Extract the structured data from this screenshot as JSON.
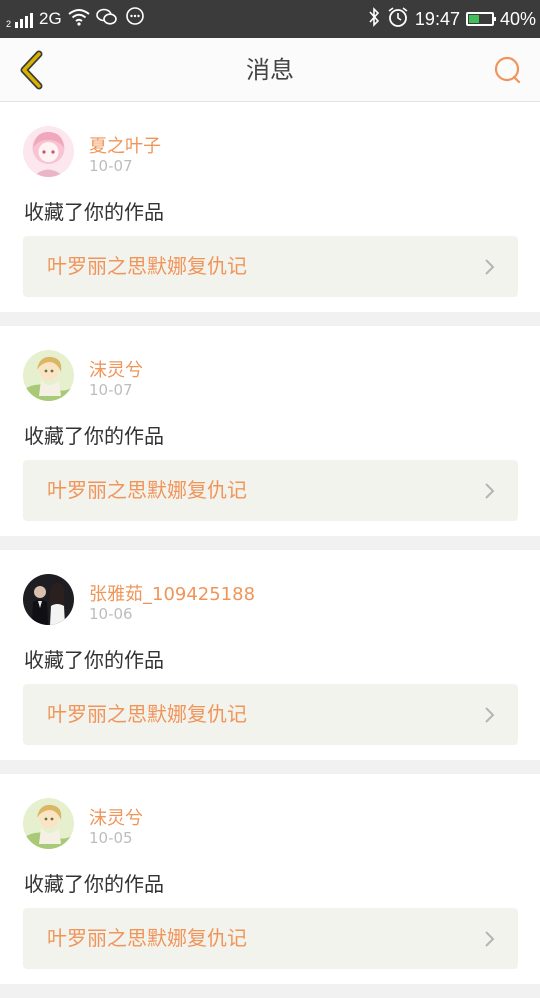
{
  "status_bar": {
    "network": "2G",
    "sim_slot": "2",
    "time": "19:47",
    "battery": "40%",
    "battery_level": 0.4,
    "battery_color": "#3fbf55"
  },
  "header": {
    "title": "消息"
  },
  "colors": {
    "accent": "#f0955a",
    "back_icon": "#d7b300"
  },
  "messages": [
    {
      "username": "夏之叶子",
      "date": "10-07",
      "action": "收藏了你的作品",
      "work_title": "叶罗丽之思默娜复仇记",
      "avatar_icon": "pink-anime-avatar"
    },
    {
      "username": "沫灵兮",
      "date": "10-07",
      "action": "收藏了你的作品",
      "work_title": "叶罗丽之思默娜复仇记",
      "avatar_icon": "green-anime-avatar"
    },
    {
      "username": "张雅茹_109425188",
      "date": "10-06",
      "action": "收藏了你的作品",
      "work_title": "叶罗丽之思默娜复仇记",
      "avatar_icon": "dark-photo-avatar"
    },
    {
      "username": "沫灵兮",
      "date": "10-05",
      "action": "收藏了你的作品",
      "work_title": "叶罗丽之思默娜复仇记",
      "avatar_icon": "green-anime-avatar"
    }
  ]
}
